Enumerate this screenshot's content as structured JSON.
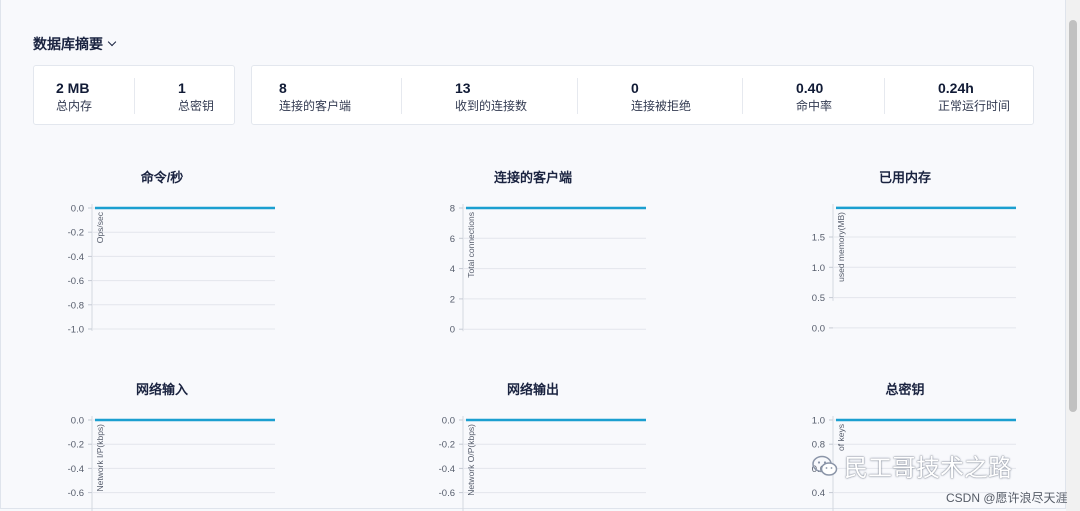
{
  "summary": {
    "title": "数据库摘要"
  },
  "stats_group_a": [
    {
      "value": "2 MB",
      "label": "总内存"
    },
    {
      "value": "1",
      "label": "总密钥"
    }
  ],
  "stats_group_b": [
    {
      "value": "8",
      "label": "连接的客户端"
    },
    {
      "value": "13",
      "label": "收到的连接数"
    },
    {
      "value": "0",
      "label": "连接被拒绝"
    },
    {
      "value": "0.40",
      "label": "命中率"
    },
    {
      "value": "0.24h",
      "label": "正常运行时间"
    }
  ],
  "colors": {
    "series": "#1b9fd0",
    "grid": "#e3e6ec",
    "tick": "#555c6b"
  },
  "watermark": {
    "text": "民工哥技术之路",
    "icon": "wechat-icon",
    "credit": "CSDN @愿许浪尽天涯"
  },
  "chart_data": [
    {
      "type": "line",
      "title": "命令/秒",
      "ylabel": "Ops/sec",
      "ticks": [
        "0.0",
        "-0.2",
        "-0.4",
        "-0.6",
        "-0.8",
        "-1.0"
      ],
      "ylim": [
        -1.0,
        0.0
      ],
      "series": [
        {
          "values": [
            0,
            0
          ]
        }
      ]
    },
    {
      "type": "line",
      "title": "连接的客户端",
      "ylabel": "Total connections",
      "ticks": [
        "8",
        "6",
        "4",
        "2",
        "0"
      ],
      "ylim": [
        0,
        8
      ],
      "series": [
        {
          "values": [
            8,
            8
          ]
        }
      ]
    },
    {
      "type": "line",
      "title": "已用内存",
      "ylabel": "used memory(MB)",
      "ticks": [
        "1.5",
        "1.0",
        "0.5",
        "0.0"
      ],
      "ylim": [
        0,
        1.98
      ],
      "series": [
        {
          "values": [
            1.98,
            1.98
          ]
        }
      ]
    },
    {
      "type": "line",
      "title": "网络输入",
      "ylabel": "Network I/P(kbps)",
      "ticks": [
        "0.0",
        "-0.2",
        "-0.4",
        "-0.6"
      ],
      "ylim": [
        -1.0,
        0.0
      ],
      "series": [
        {
          "values": [
            0,
            0
          ]
        }
      ]
    },
    {
      "type": "line",
      "title": "网络输出",
      "ylabel": "Network O/P(kbps)",
      "ticks": [
        "0.0",
        "-0.2",
        "-0.4",
        "-0.6"
      ],
      "ylim": [
        -1.0,
        0.0
      ],
      "series": [
        {
          "values": [
            0,
            0
          ]
        }
      ]
    },
    {
      "type": "line",
      "title": "总密钥",
      "ylabel": "of keys",
      "ticks": [
        "1.0",
        "0.8",
        "0.6",
        "0.4"
      ],
      "ylim": [
        0,
        1.0
      ],
      "series": [
        {
          "values": [
            1.0,
            1.0
          ]
        }
      ]
    }
  ]
}
